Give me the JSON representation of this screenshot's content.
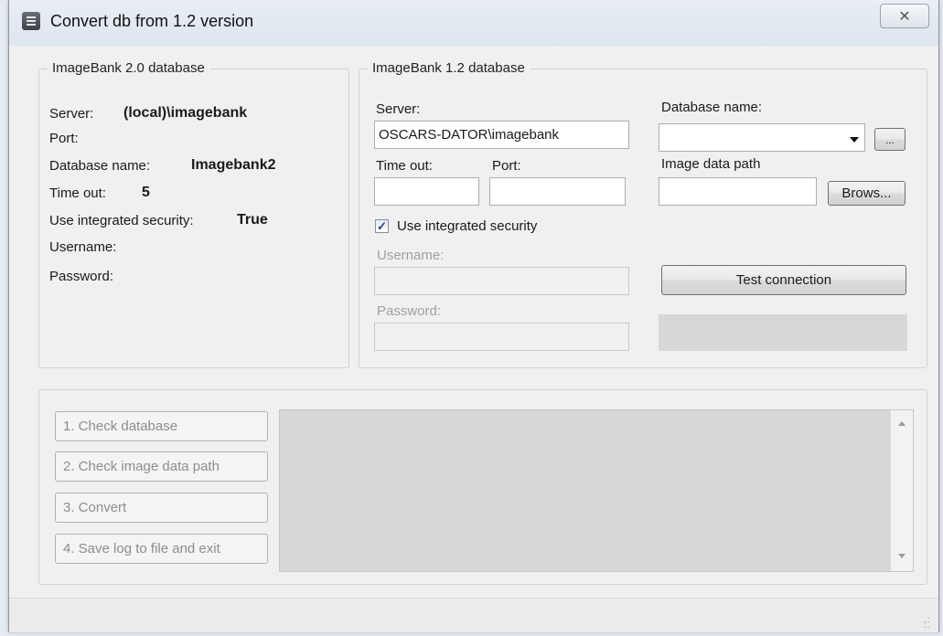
{
  "window": {
    "title": "Convert db from 1.2 version",
    "close_glyph": "✕",
    "app_icon": "database-icon"
  },
  "left_group": {
    "legend": "ImageBank 2.0 database",
    "server_label": "Server:",
    "server_value": "(local)\\imagebank",
    "port_label": "Port:",
    "dbname_label": "Database name:",
    "dbname_value": "Imagebank2",
    "timeout_label": "Time out:",
    "timeout_value": "5",
    "integrated_label": "Use integrated security:",
    "integrated_value": "True",
    "username_label": "Username:",
    "password_label": "Password:"
  },
  "right_group": {
    "legend": "ImageBank 1.2 database",
    "server_label": "Server:",
    "server_value": "OSCARS-DATOR\\imagebank",
    "timeout_label": "Time out:",
    "timeout_value": "",
    "port_label": "Port:",
    "port_value": "",
    "dbname_label": "Database name:",
    "dbname_value": "",
    "browse_small_label": "...",
    "image_path_label": "Image data path",
    "image_path_value": "",
    "browse_label": "Brows...",
    "integrated_checkbox_label": "Use integrated security",
    "integrated_checked": true,
    "username_label": "Username:",
    "password_label": "Password:",
    "test_button_label": "Test connection",
    "status_text": ""
  },
  "steps": {
    "check_db": "1. Check database",
    "check_path": "2. Check image data path",
    "convert": "3. Convert",
    "save_log": "4. Save log to file and exit"
  },
  "log": {
    "text": ""
  },
  "colors": {
    "window_bg": "#f0f0f0",
    "check_mark": "#2a3e8c",
    "disabled_text": "#8d8d8d"
  }
}
